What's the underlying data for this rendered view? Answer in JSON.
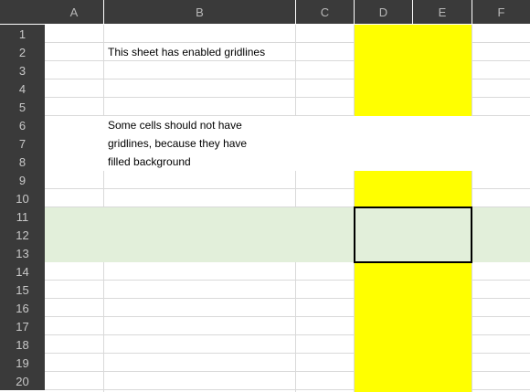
{
  "columns": [
    "A",
    "B",
    "C",
    "D",
    "E",
    "F"
  ],
  "rows": [
    "1",
    "2",
    "3",
    "4",
    "5",
    "6",
    "7",
    "8",
    "9",
    "10",
    "11",
    "12",
    "13",
    "14",
    "15",
    "16",
    "17",
    "18",
    "19",
    "20"
  ],
  "cells": {
    "b2": "This sheet has enabled gridlines",
    "b6": "Some cells should not have",
    "b7": "gridlines, because they have",
    "b8": "filled background"
  },
  "colors": {
    "header_bg": "#3a3a3a",
    "header_text": "#c8c8c8",
    "gridline": "#d9d9d9",
    "yellow_fill": "#ffff00",
    "green_fill": "#e2efda",
    "selection_border": "#000000"
  }
}
